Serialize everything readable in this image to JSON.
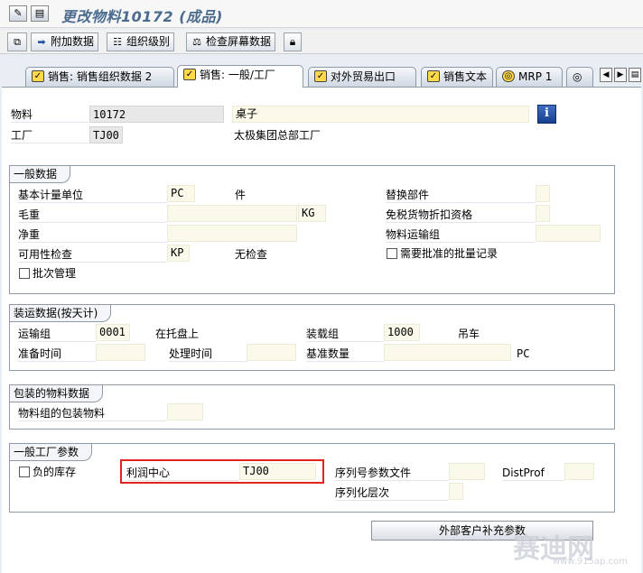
{
  "window": {
    "title": "更改物料10172 (成品)"
  },
  "toolbar": {
    "items": [
      {
        "label": "附加数据",
        "icon": "arrow-right-icon"
      },
      {
        "label": "组织级别",
        "icon": "org-levels-icon"
      },
      {
        "label": "检查屏幕数据",
        "icon": "check-screen-icon"
      }
    ]
  },
  "tabs": [
    {
      "label": "销售: 销售组织数据 2"
    },
    {
      "label": "销售: 一般/工厂"
    },
    {
      "label": "对外贸易出口"
    },
    {
      "label": "销售文本"
    },
    {
      "label": "MRP 1"
    }
  ],
  "header": {
    "material_label": "物料",
    "material_value": "10172",
    "material_desc": "桌子",
    "plant_label": "工厂",
    "plant_value": "TJ00",
    "plant_desc": "太极集团总部工厂"
  },
  "general": {
    "title": "一般数据",
    "base_uom_label": "基本计量单位",
    "base_uom_value": "PC",
    "base_uom_text": "件",
    "replacement_label": "替换部件",
    "gross_weight_label": "毛重",
    "weight_unit": "KG",
    "duty_free_label": "免税货物折扣资格",
    "net_weight_label": "净重",
    "transport_group_label": "物料运输组",
    "availability_label": "可用性检查",
    "availability_value": "KP",
    "availability_text": "无检查",
    "approved_batch_label": "需要批准的批量记录",
    "batch_mgmt_label": "批次管理"
  },
  "shipping": {
    "title": "装运数据(按天计)",
    "trans_group_label": "运输组",
    "trans_group_value": "0001",
    "trans_group_text": "在托盘上",
    "loading_group_label": "装载组",
    "loading_group_value": "1000",
    "loading_group_text": "吊车",
    "setup_time_label": "准备时间",
    "proc_time_label": "处理时间",
    "base_qty_label": "基准数量",
    "base_qty_unit": "PC"
  },
  "packaging": {
    "title": "包装的物料数据",
    "pack_group_label": "物料组的包装物料"
  },
  "plant_params": {
    "title": "一般工厂参数",
    "neg_stock_label": "负的库存",
    "profit_center_label": "利润中心",
    "profit_center_value": "TJ00",
    "serial_profile_label": "序列号参数文件",
    "distprof_label": "DistProf",
    "serial_level_label": "序列化层次"
  },
  "footer": {
    "customer_button": "外部客户补充参数"
  },
  "watermark": {
    "text": "赛迪网",
    "url": "www.915ap.com"
  }
}
